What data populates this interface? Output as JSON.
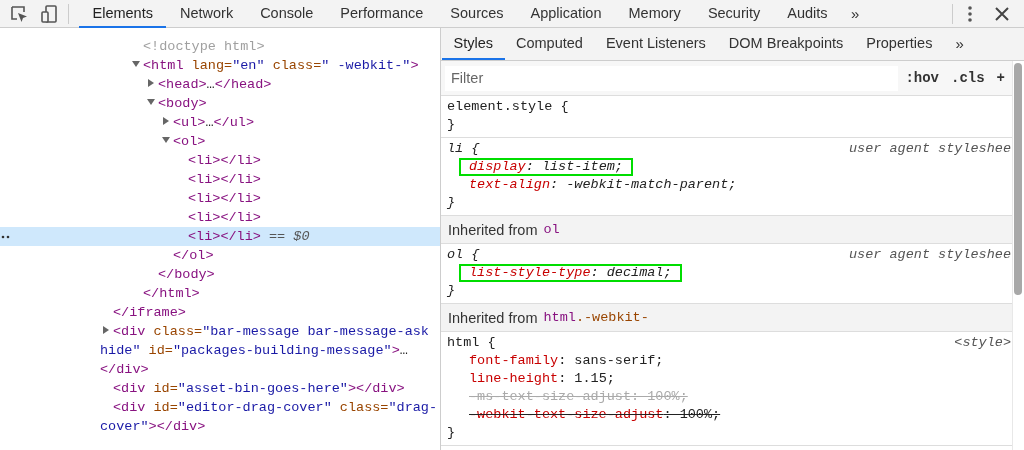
{
  "toolbar": {
    "tabs": [
      {
        "label": "Elements",
        "selected": true
      },
      {
        "label": "Network",
        "selected": false
      },
      {
        "label": "Console",
        "selected": false
      },
      {
        "label": "Performance",
        "selected": false
      },
      {
        "label": "Sources",
        "selected": false
      },
      {
        "label": "Application",
        "selected": false
      },
      {
        "label": "Memory",
        "selected": false
      },
      {
        "label": "Security",
        "selected": false
      },
      {
        "label": "Audits",
        "selected": false
      }
    ],
    "more": "»"
  },
  "dom_tree": [
    {
      "children": [
        {
          "children": [
            {
              "parts": [
                {
                  "kind": "doctype",
                  "text": "<!doctype html>"
                }
              ],
              "selected": false
            },
            {
              "parts": [
                {
                  "kind": "tag",
                  "text": "<html"
                },
                {
                  "kind": "attr",
                  "text": " lang="
                },
                {
                  "kind": "value",
                  "text": "\"en\""
                },
                {
                  "kind": "attr",
                  "text": " class="
                },
                {
                  "kind": "value",
                  "text": "\" -webkit-\""
                },
                {
                  "kind": "tag",
                  "text": ">"
                }
              ],
              "expanded": true,
              "selected": false,
              "children": [
                {
                  "parts": [
                    {
                      "kind": "tag",
                      "text": "<head>"
                    },
                    {
                      "kind": "text",
                      "text": "…"
                    },
                    {
                      "kind": "tag",
                      "text": "</head>"
                    }
                  ],
                  "expanded": false,
                  "selected": false
                },
                {
                  "parts": [
                    {
                      "kind": "tag",
                      "text": "<body>"
                    }
                  ],
                  "expanded": true,
                  "selected": false,
                  "children": [
                    {
                      "parts": [
                        {
                          "kind": "tag",
                          "text": "<ul>"
                        },
                        {
                          "kind": "text",
                          "text": "…"
                        },
                        {
                          "kind": "tag",
                          "text": "</ul>"
                        }
                      ],
                      "expanded": false,
                      "selected": false
                    },
                    {
                      "parts": [
                        {
                          "kind": "tag",
                          "text": "<ol>"
                        }
                      ],
                      "expanded": true,
                      "selected": false,
                      "children": [
                        {
                          "parts": [
                            {
                              "kind": "tag",
                              "text": "<li></li>"
                            }
                          ],
                          "selected": false
                        },
                        {
                          "parts": [
                            {
                              "kind": "tag",
                              "text": "<li></li>"
                            }
                          ],
                          "selected": false
                        },
                        {
                          "parts": [
                            {
                              "kind": "tag",
                              "text": "<li></li>"
                            }
                          ],
                          "selected": false
                        },
                        {
                          "parts": [
                            {
                              "kind": "tag",
                              "text": "<li></li>"
                            }
                          ],
                          "selected": false
                        },
                        {
                          "parts": [
                            {
                              "kind": "tag",
                              "text": "<li></li>"
                            },
                            {
                              "kind": "ref",
                              "text": " == $0"
                            }
                          ],
                          "selected": true
                        }
                      ],
                      "closing": [
                        {
                          "kind": "tag",
                          "text": "</ol>"
                        }
                      ]
                    }
                  ],
                  "closing": [
                    {
                      "kind": "tag",
                      "text": "</body>"
                    }
                  ]
                }
              ],
              "closing": [
                {
                  "kind": "tag",
                  "text": "</html>"
                }
              ]
            }
          ]
        }
      ],
      "closing": [
        {
          "kind": "tag",
          "text": "</iframe>"
        }
      ]
    },
    {
      "parts": [
        {
          "kind": "tag",
          "text": "<div"
        },
        {
          "kind": "attr",
          "text": " class="
        },
        {
          "kind": "value",
          "text": "\"bar-message bar-message-ask hide\""
        },
        {
          "kind": "attr",
          "text": " id="
        },
        {
          "kind": "value",
          "text": "\"packages-building-message\""
        },
        {
          "kind": "tag",
          "text": ">"
        },
        {
          "kind": "text",
          "text": "…"
        },
        {
          "kind": "tag",
          "text": "</div>"
        }
      ],
      "expanded": false,
      "selected": false
    },
    {
      "parts": [
        {
          "kind": "tag",
          "text": "<div"
        },
        {
          "kind": "attr",
          "text": " id="
        },
        {
          "kind": "value",
          "text": "\"asset-bin-goes-here\""
        },
        {
          "kind": "tag",
          "text": "></div>"
        }
      ],
      "selected": false
    },
    {
      "parts": [
        {
          "kind": "tag",
          "text": "<div"
        },
        {
          "kind": "attr",
          "text": " id="
        },
        {
          "kind": "value",
          "text": "\"editor-drag-cover\""
        },
        {
          "kind": "attr",
          "text": " class="
        },
        {
          "kind": "value",
          "text": "\"drag-cover\""
        },
        {
          "kind": "tag",
          "text": "></div>"
        }
      ],
      "selected": false
    }
  ],
  "sidebar": {
    "tabs": [
      {
        "label": "Styles",
        "selected": true
      },
      {
        "label": "Computed",
        "selected": false
      },
      {
        "label": "Event Listeners",
        "selected": false
      },
      {
        "label": "DOM Breakpoints",
        "selected": false
      },
      {
        "label": "Properties",
        "selected": false
      }
    ],
    "more": "»",
    "filter": {
      "placeholder": "Filter"
    },
    "buttons": [
      ":hov",
      ".cls",
      "+"
    ],
    "rules": [
      {
        "kind": "rule",
        "selector": "element.style {",
        "user_agent": false,
        "close": "}"
      },
      {
        "kind": "rule",
        "selector": "li {",
        "user_agent": true,
        "source": "user agent styleshee",
        "close": "}",
        "properties": [
          {
            "name": "display",
            "rest": ": list-item;",
            "highlighted": true,
            "overridden": false,
            "inactive": false
          },
          {
            "name": "text-align",
            "rest": ": -webkit-match-parent;",
            "highlighted": false,
            "overridden": false,
            "inactive": false
          }
        ]
      },
      {
        "kind": "inherited",
        "label": "Inherited from",
        "selector": [
          {
            "kind": "tag",
            "text": "ol"
          }
        ]
      },
      {
        "kind": "rule",
        "selector": "ol {",
        "user_agent": true,
        "source": "user agent styleshee",
        "close": "}",
        "properties": [
          {
            "name": "list-style-type",
            "rest": ": decimal;",
            "highlighted": true,
            "overridden": false,
            "inactive": false
          }
        ]
      },
      {
        "kind": "inherited",
        "label": "Inherited from",
        "selector": [
          {
            "kind": "tag",
            "text": "html"
          },
          {
            "kind": "attr",
            "text": ".-webkit-"
          }
        ]
      },
      {
        "kind": "rule",
        "selector": "html {",
        "user_agent": false,
        "source": "<style>",
        "close": "}",
        "properties": [
          {
            "name": "font-family",
            "rest": ": sans-serif;",
            "highlighted": false,
            "overridden": false,
            "inactive": false
          },
          {
            "name": "line-height",
            "rest": ": 1.15;",
            "highlighted": false,
            "overridden": false,
            "inactive": false
          },
          {
            "name": "-ms-text-size-adjust",
            "rest": ": 100%;",
            "highlighted": false,
            "overridden": true,
            "inactive": true
          },
          {
            "name": "-webkit-text-size-adjust",
            "rest": ": 100%;",
            "highlighted": false,
            "overridden": true,
            "inactive": false
          }
        ]
      }
    ]
  }
}
